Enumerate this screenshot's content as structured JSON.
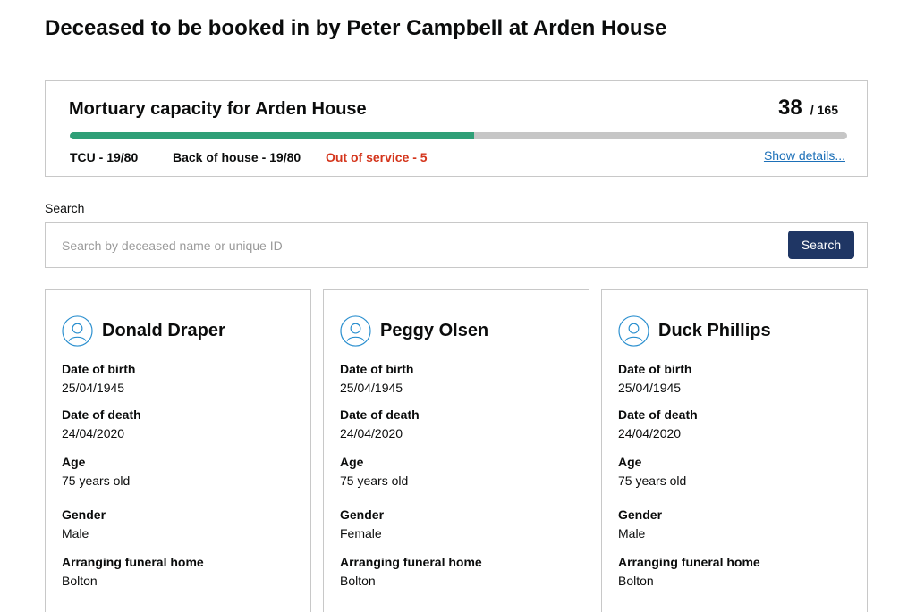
{
  "page": {
    "title": "Deceased to be booked in by Peter Campbell at Arden House"
  },
  "capacity": {
    "title": "Mortuary capacity for Arden House",
    "count": "38",
    "separator": "/",
    "total": "165",
    "fill_fraction": 0.52,
    "tcu": "TCU - 19/80",
    "back_of_house": "Back of house - 19/80",
    "out_of_service": "Out of service - 5",
    "show_details": "Show details..."
  },
  "search": {
    "label": "Search",
    "placeholder": "Search by deceased name or unique ID",
    "value": "",
    "button_label": "Search"
  },
  "field_labels": {
    "dob": "Date of birth",
    "dod": "Date of death",
    "age": "Age",
    "gender": "Gender",
    "funeral_home": "Arranging funeral home"
  },
  "cards": [
    {
      "name": "Donald Draper",
      "dob": "25/04/1945",
      "dod": "24/04/2020",
      "age": "75 years old",
      "gender": "Male",
      "funeral_home": "Bolton"
    },
    {
      "name": "Peggy Olsen",
      "dob": "25/04/1945",
      "dod": "24/04/2020",
      "age": "75 years old",
      "gender": "Female",
      "funeral_home": "Bolton"
    },
    {
      "name": "Duck Phillips",
      "dob": "25/04/1945",
      "dod": "24/04/2020",
      "age": "75 years old",
      "gender": "Male",
      "funeral_home": "Bolton"
    }
  ],
  "colors": {
    "progress_fill": "#2f9f77",
    "progress_track": "#c6c6c6",
    "out_of_service": "#d4351c",
    "link": "#1d70b8",
    "button": "#1f3664",
    "avatar": "#2a8fcf"
  },
  "icons": {
    "avatar": "user-circle-icon"
  }
}
